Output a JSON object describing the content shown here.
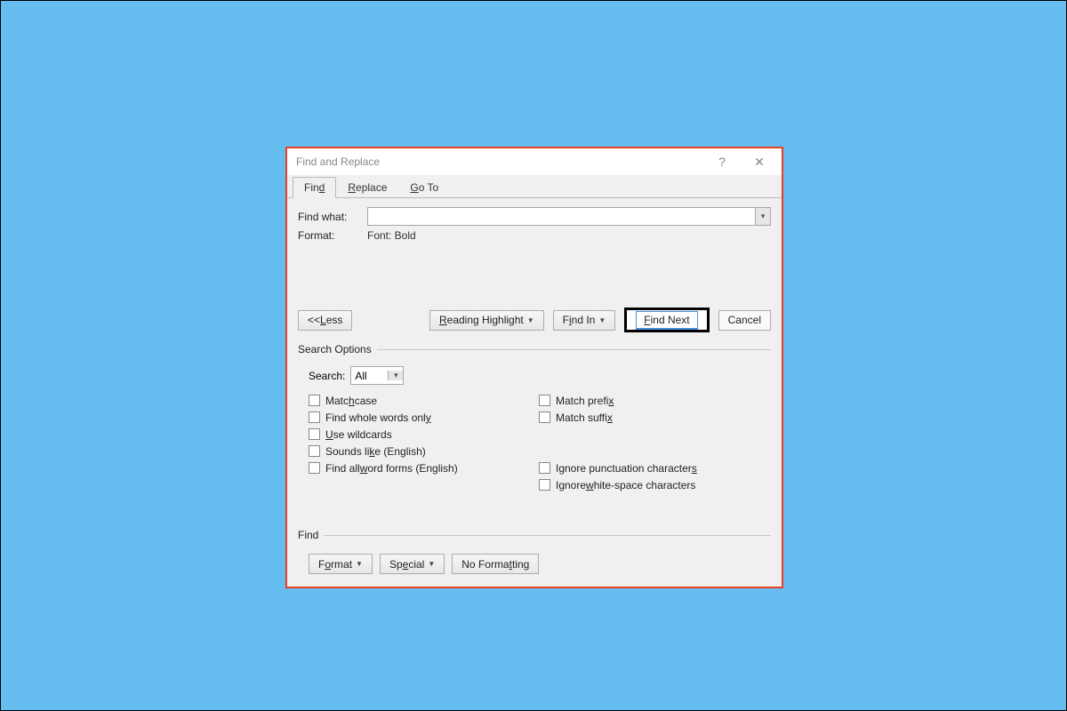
{
  "window": {
    "title": "Find and Replace",
    "help_icon": "?",
    "close_icon": "✕"
  },
  "tabs": {
    "find_pre": "Fin",
    "find_ul": "d",
    "replace_ul": "R",
    "replace_post": "eplace",
    "goto_ul": "G",
    "goto_post": "o To"
  },
  "find": {
    "label_pre": "Fi",
    "label_ul": "n",
    "label_post": "d what:",
    "value": "",
    "format_label": "Format:",
    "format_value": "Font: Bold"
  },
  "buttons": {
    "less_pre": "<<  ",
    "less_ul": "L",
    "less_post": "ess",
    "reading_ul": "R",
    "reading_post": "eading Highlight",
    "findin_pre": "F",
    "findin_ul": "i",
    "findin_post": "nd In",
    "findnext_ul": "F",
    "findnext_post": "ind Next",
    "cancel": "Cancel"
  },
  "search_options": {
    "legend": "Search Options",
    "search_label": "Searc",
    "search_ul": "h",
    "search_post": ":",
    "search_value": "All",
    "left": {
      "match_case_pre": "Matc",
      "match_case_ul": "h",
      "match_case_post": " case",
      "whole_pre": "Find whole words onl",
      "whole_ul": "y",
      "whole_post": "",
      "wild_pre": "",
      "wild_ul": "U",
      "wild_post": "se wildcards",
      "sounds_pre": "Sounds li",
      "sounds_ul": "k",
      "sounds_post": "e (English)",
      "forms_pre": "Find all ",
      "forms_ul": "w",
      "forms_post": "ord forms (English)"
    },
    "right": {
      "prefix_pre": "Match prefi",
      "prefix_ul": "x",
      "prefix_post": "",
      "suffix_pre": "Match suffi",
      "suffix_ul": "x",
      "suffix_post": "",
      "punc_pre": "Ignore punctuation character",
      "punc_ul": "s",
      "punc_post": "",
      "ws_pre": "Ignore ",
      "ws_ul": "w",
      "ws_post": "hite-space characters"
    }
  },
  "find_group": {
    "legend": "Find",
    "format_pre": "F",
    "format_ul": "o",
    "format_post": "rmat",
    "special_pre": "Sp",
    "special_ul": "e",
    "special_post": "cial",
    "noformat_pre": "No Forma",
    "noformat_ul": "t",
    "noformat_post": "ting"
  }
}
